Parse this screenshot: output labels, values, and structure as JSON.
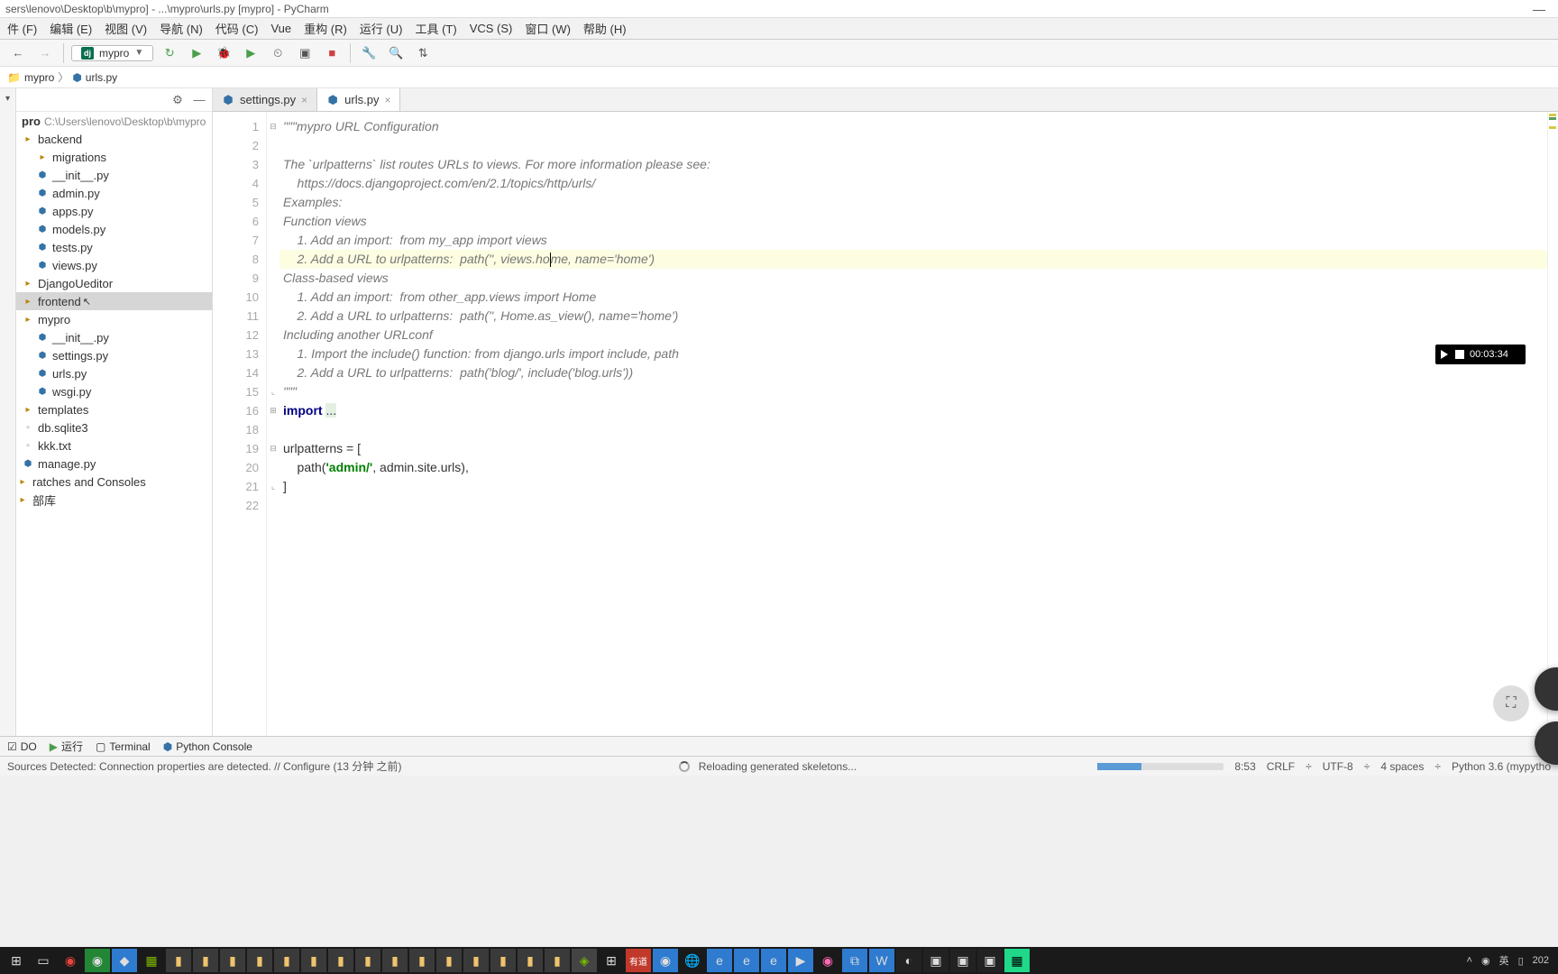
{
  "window": {
    "title": "sers\\lenovo\\Desktop\\b\\mypro] - ...\\mypro\\urls.py [mypro] - PyCharm",
    "min": "—",
    "max": "□",
    "close": "×"
  },
  "menu": {
    "items": [
      "件 (F)",
      "编辑 (E)",
      "视图 (V)",
      "导航 (N)",
      "代码 (C)",
      "Vue",
      "重构 (R)",
      "运行 (U)",
      "工具 (T)",
      "VCS (S)",
      "窗口 (W)",
      "帮助 (H)"
    ]
  },
  "toolbar": {
    "run_config": "mypro"
  },
  "nav": {
    "proj": "mypro",
    "file": "urls.py"
  },
  "tree": {
    "root_label": "pro",
    "root_hint": "C:\\Users\\lenovo\\Desktop\\b\\mypro",
    "items": [
      {
        "label": "backend",
        "indent": 6,
        "type": "dir"
      },
      {
        "label": "migrations",
        "indent": 22,
        "type": "dir"
      },
      {
        "label": "__init__.py",
        "indent": 22,
        "type": "py"
      },
      {
        "label": "admin.py",
        "indent": 22,
        "type": "py"
      },
      {
        "label": "apps.py",
        "indent": 22,
        "type": "py"
      },
      {
        "label": "models.py",
        "indent": 22,
        "type": "py"
      },
      {
        "label": "tests.py",
        "indent": 22,
        "type": "py"
      },
      {
        "label": "views.py",
        "indent": 22,
        "type": "py"
      },
      {
        "label": "DjangoUeditor",
        "indent": 6,
        "type": "dir"
      },
      {
        "label": "frontend",
        "indent": 6,
        "type": "dir",
        "selected": true,
        "cursor": true
      },
      {
        "label": "mypro",
        "indent": 6,
        "type": "dir"
      },
      {
        "label": "__init__.py",
        "indent": 22,
        "type": "py"
      },
      {
        "label": "settings.py",
        "indent": 22,
        "type": "py"
      },
      {
        "label": "urls.py",
        "indent": 22,
        "type": "py"
      },
      {
        "label": "wsgi.py",
        "indent": 22,
        "type": "py"
      },
      {
        "label": "templates",
        "indent": 6,
        "type": "dir"
      },
      {
        "label": "db.sqlite3",
        "indent": 6,
        "type": "file"
      },
      {
        "label": "kkk.txt",
        "indent": 6,
        "type": "file"
      },
      {
        "label": "manage.py",
        "indent": 6,
        "type": "py"
      },
      {
        "label": "ratches and Consoles",
        "indent": 0,
        "type": "special"
      },
      {
        "label": "部库",
        "indent": 0,
        "type": "special"
      }
    ]
  },
  "tabs": {
    "t1": "settings.py",
    "t2": "urls.py"
  },
  "code": {
    "lines": [
      {
        "n": 1,
        "html": "<span class='docstr'>\"\"\"mypro URL Configuration</span>",
        "fold": "⊟"
      },
      {
        "n": 2,
        "html": ""
      },
      {
        "n": 3,
        "html": "<span class='docstr'>The `urlpatterns` list routes URLs to views. For more information please see:</span>"
      },
      {
        "n": 4,
        "html": "<span class='docstr'>    https://docs.djangoproject.com/en/2.1/topics/http/urls/</span>"
      },
      {
        "n": 5,
        "html": "<span class='docstr'>Examples:</span>"
      },
      {
        "n": 6,
        "html": "<span class='docstr'>Function views</span>"
      },
      {
        "n": 7,
        "html": "<span class='docstr'>    1. Add an import:  from my_app import views</span>"
      },
      {
        "n": 8,
        "html": "<span class='docstr'>    2. Add a URL to urlpatterns:  path('', views.ho</span><span class='caret'></span><span class='docstr'>me, name='home')</span>",
        "hl": true
      },
      {
        "n": 9,
        "html": "<span class='docstr'>Class-based views</span>"
      },
      {
        "n": 10,
        "html": "<span class='docstr'>    1. Add an import:  from other_app.views import Home</span>"
      },
      {
        "n": 11,
        "html": "<span class='docstr'>    2. Add a URL to urlpatterns:  path('', Home.as_view(), name='home')</span>"
      },
      {
        "n": 12,
        "html": "<span class='docstr'>Including another URLconf</span>"
      },
      {
        "n": 13,
        "html": "<span class='docstr'>    1. Import the include() function: from django.urls import include, path</span>"
      },
      {
        "n": 14,
        "html": "<span class='docstr'>    2. Add a URL to urlpatterns:  path('blog/', include('blog.urls'))</span>"
      },
      {
        "n": 15,
        "html": "<span class='docstr'>\"\"\"</span>",
        "fold": "⌞"
      },
      {
        "n": 16,
        "html": "<span class='kw'>import</span> <span style='background:#e4efe4'>...</span>",
        "fold": "⊞"
      },
      {
        "n": 18,
        "html": ""
      },
      {
        "n": 19,
        "html": "urlpatterns = [",
        "fold": "⊟"
      },
      {
        "n": 20,
        "html": "    path(<span class='str'>'admin/'</span>, admin.site.urls),"
      },
      {
        "n": 21,
        "html": "]",
        "fold": "⌞"
      },
      {
        "n": 22,
        "html": ""
      }
    ]
  },
  "recorder": {
    "time": "00:03:34"
  },
  "bottom_tools": {
    "todo": "DO",
    "run": "运行",
    "terminal": "Terminal",
    "pyconsole": "Python Console"
  },
  "status": {
    "left_msg": "Sources Detected: Connection properties are detected. // Configure (13 分钟 之前)",
    "reload": "Reloading generated skeletons...",
    "pos": "8:53",
    "lineend": "CRLF",
    "encoding": "UTF-8",
    "indent": "4 spaces",
    "interp": "Python 3.6 (mypytho"
  },
  "taskbar": {
    "tray_ime": "英",
    "tray_date": "202"
  }
}
